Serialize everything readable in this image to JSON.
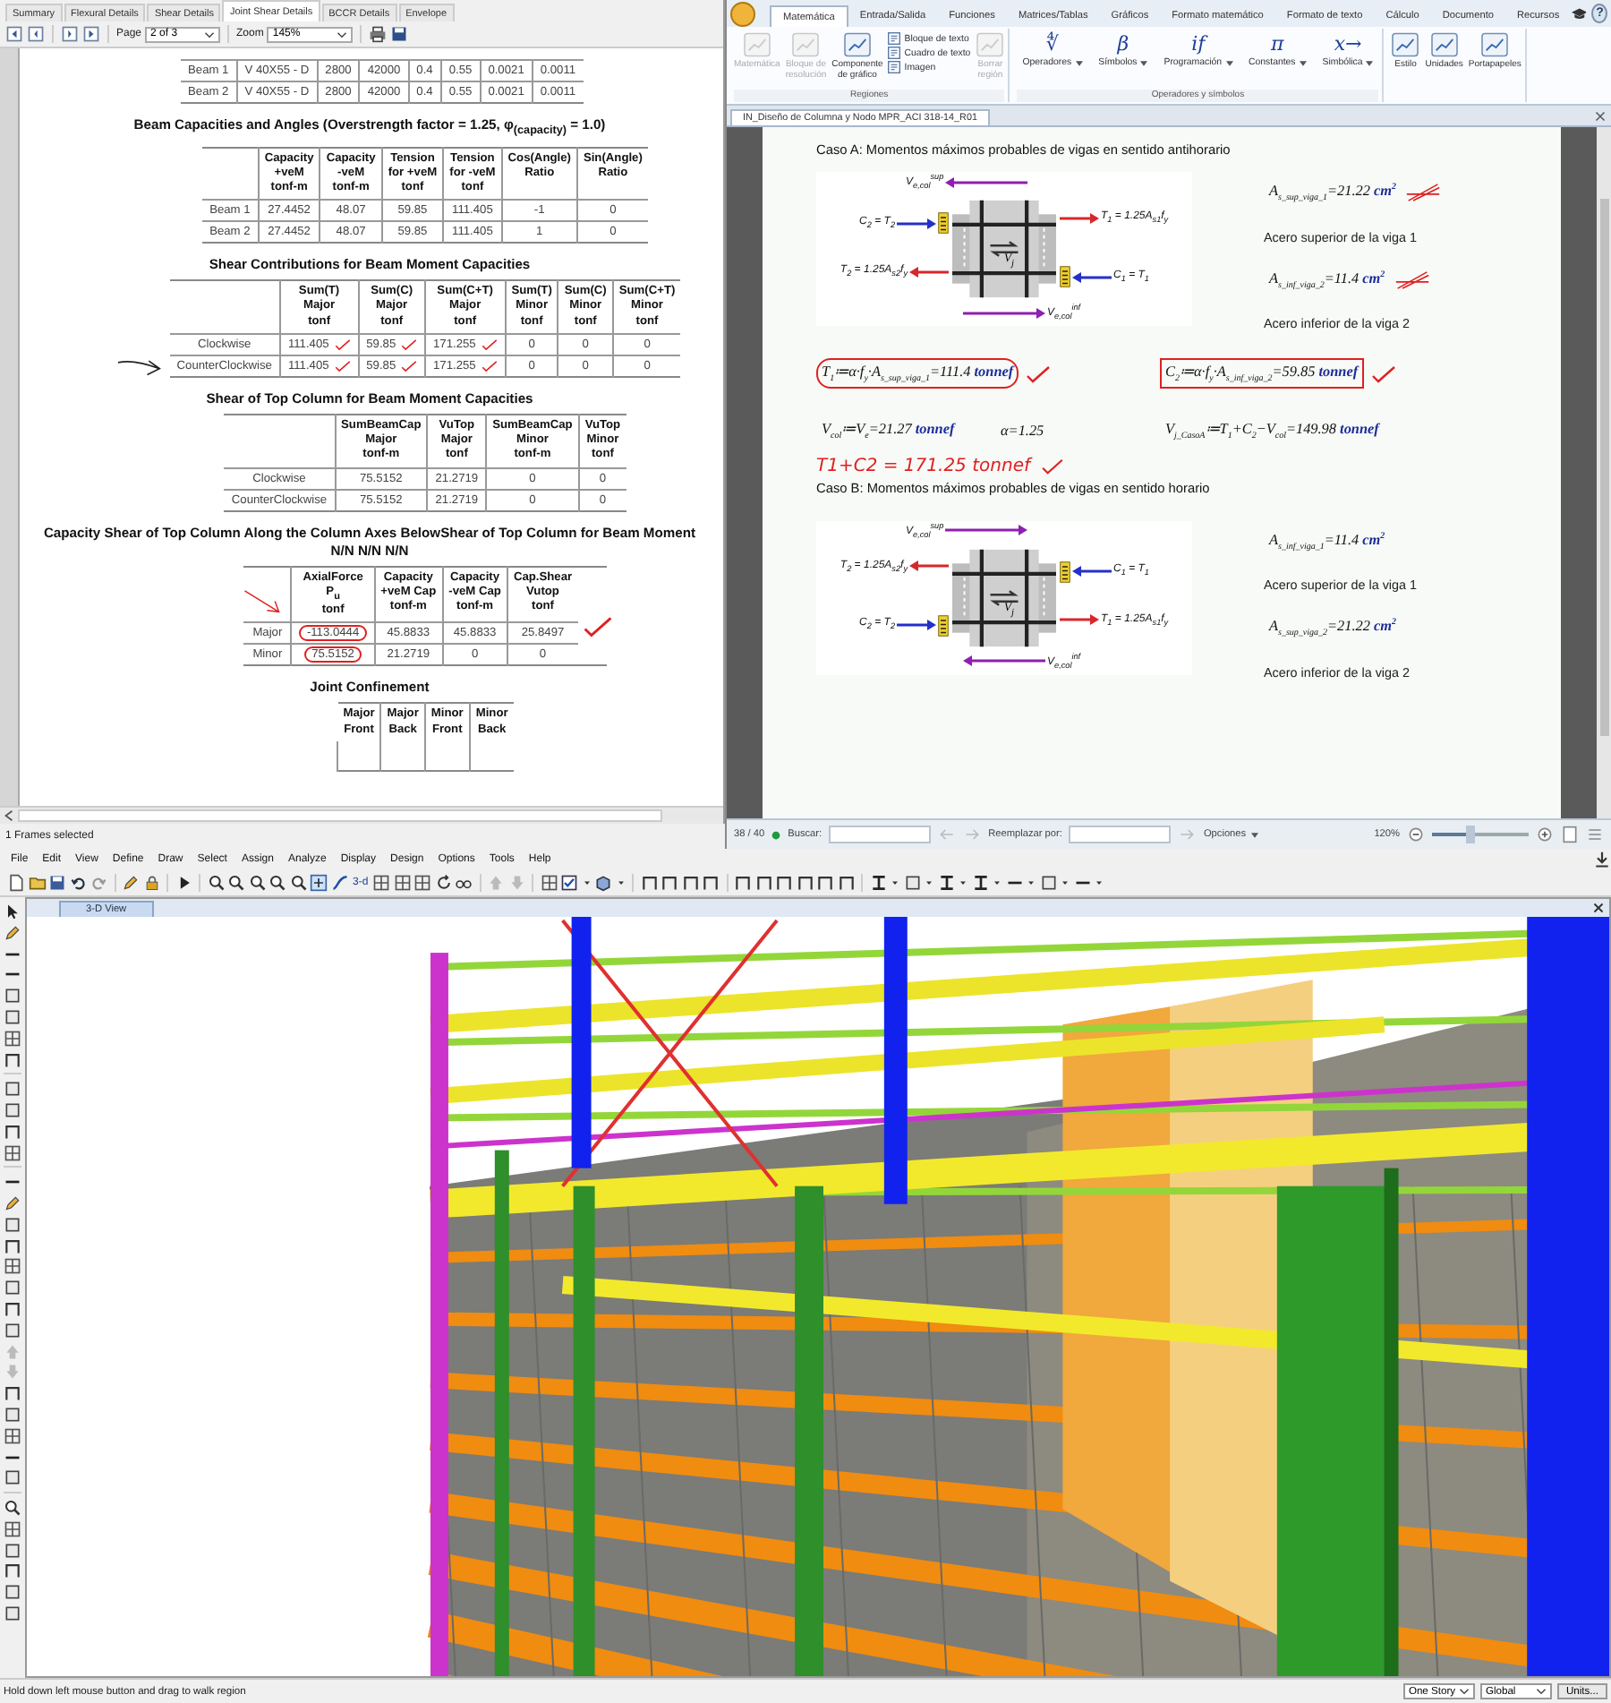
{
  "report": {
    "tabs": [
      {
        "label": "Summary",
        "selected": false
      },
      {
        "label": "Flexural Details",
        "selected": false
      },
      {
        "label": "Shear Details",
        "selected": false
      },
      {
        "label": "Joint Shear Details",
        "selected": true
      },
      {
        "label": "BCCR Details",
        "selected": false
      },
      {
        "label": "Envelope",
        "selected": false
      }
    ],
    "page_label": "Page",
    "page_value": "2 of 3",
    "zoom_label": "Zoom",
    "zoom_value": "145%",
    "sections": [
      {
        "rows": [
          {
            "label": "Beam 1",
            "cells": [
              "V 40X55 - D",
              "2800",
              "42000",
              "0.4",
              "0.55",
              "0.0021",
              "0.0011"
            ]
          },
          {
            "label": "Beam 2",
            "cells": [
              "V 40X55 - D",
              "2800",
              "42000",
              "0.4",
              "0.55",
              "0.0021",
              "0.0011"
            ]
          }
        ]
      },
      {
        "title": "Beam Capacities and Angles (Overstrength factor = 1.25, φ$_{(capacity)}$ = 1.0)",
        "columns": [
          "Capacity\n+veM\ntonf-m",
          "Capacity\n-veM\ntonf-m",
          "Tension\nfor +veM\ntonf",
          "Tension\nfor -veM\ntonf",
          "Cos(Angle)\nRatio",
          "Sin(Angle)\nRatio"
        ],
        "rows": [
          {
            "label": "Beam 1",
            "cells": [
              "27.4452",
              "48.07",
              "59.85",
              "111.405",
              "-1",
              "0"
            ]
          },
          {
            "label": "Beam 2",
            "cells": [
              "27.4452",
              "48.07",
              "59.85",
              "111.405",
              "1",
              "0"
            ]
          }
        ]
      },
      {
        "title": "Shear Contributions for Beam Moment Capacities",
        "columns": [
          "Sum(T)\nMajor\ntonf",
          "Sum(C)\nMajor\ntonf",
          "Sum(C+T)\nMajor\ntonf",
          "Sum(T)\nMinor\ntonf",
          "Sum(C)\nMinor\ntonf",
          "Sum(C+T)\nMinor\ntonf"
        ],
        "rows": [
          {
            "label": "Clockwise",
            "cells": [
              "111.405",
              "59.85",
              "171.255",
              "0",
              "0",
              "0"
            ],
            "ticks": [
              true,
              true,
              true,
              false,
              false,
              false
            ],
            "arrow": false
          },
          {
            "label": "CounterClockwise",
            "cells": [
              "111.405",
              "59.85",
              "171.255",
              "0",
              "0",
              "0"
            ],
            "ticks": [
              true,
              true,
              true,
              false,
              false,
              false
            ],
            "arrow": true
          }
        ]
      },
      {
        "title": "Shear of Top Column for Beam Moment Capacities",
        "columns": [
          "SumBeamCap\nMajor\ntonf-m",
          "VuTop\nMajor\ntonf",
          "SumBeamCap\nMinor\ntonf-m",
          "VuTop\nMinor\ntonf"
        ],
        "rows": [
          {
            "label": "Clockwise",
            "cells": [
              "75.5152",
              "21.2719",
              "0",
              "0"
            ]
          },
          {
            "label": "CounterClockwise",
            "cells": [
              "75.5152",
              "21.2719",
              "0",
              "0"
            ]
          }
        ]
      },
      {
        "title": "Capacity Shear of Top Column Along the Column Axes BelowShear of Top Column for Beam Moment",
        "subtitle": "N/N N/N N/N",
        "columns": [
          "AxialForce\nP$_{u}$\ntonf",
          "Capacity\n+veM Cap\ntonf-m",
          "Capacity\n-veM Cap\ntonf-m",
          "Cap.Shear\nVutop\ntonf"
        ],
        "rows": [
          {
            "label": "Major",
            "cells": [
              "-113.0444",
              "45.8833",
              "45.8833",
              "25.8497"
            ],
            "circled": [
              true,
              false,
              false,
              false
            ],
            "end_tick": true
          },
          {
            "label": "Minor",
            "cells": [
              "75.5152",
              "21.2719",
              "0",
              "0"
            ],
            "circled": [
              true,
              false,
              false,
              false
            ],
            "end_tick": false
          }
        ]
      },
      {
        "title": "Joint Confinement",
        "columns": [
          "Major\nFront",
          "Major\nBack",
          "Minor\nFront",
          "Minor\nBack"
        ]
      }
    ]
  },
  "selection_status": "1 Frames selected",
  "mathcad": {
    "tabs": [
      {
        "label": "Matemática",
        "selected": true
      },
      {
        "label": "Entrada/Salida",
        "selected": false
      },
      {
        "label": "Funciones",
        "selected": false
      },
      {
        "label": "Matrices/Tablas",
        "selected": false
      },
      {
        "label": "Gráficos",
        "selected": false
      },
      {
        "label": "Formato matemático",
        "selected": false
      },
      {
        "label": "Formato de texto",
        "selected": false
      },
      {
        "label": "Cálculo",
        "selected": false
      },
      {
        "label": "Documento",
        "selected": false
      },
      {
        "label": "Recursos",
        "selected": false
      }
    ],
    "help": "?",
    "groups": [
      {
        "label": "Regiones",
        "items": [
          {
            "kind": "large",
            "label": "Matemática",
            "disabled": true
          },
          {
            "kind": "large",
            "label": "Bloque de\nresolución",
            "disabled": true
          },
          {
            "kind": "large",
            "label": "Componente\nde gráfico",
            "disabled": false
          },
          {
            "kind": "small",
            "label": "Bloque de texto",
            "disabled": false
          },
          {
            "kind": "small",
            "label": "Cuadro de texto",
            "disabled": false
          },
          {
            "kind": "small",
            "label": "Imagen",
            "disabled": false
          },
          {
            "kind": "large",
            "label": "Borrar\nregión",
            "disabled": true
          }
        ]
      },
      {
        "label": "Operadores y símbolos",
        "items": [
          {
            "kind": "glyph",
            "glyph": "∜",
            "label": "Operadores",
            "disabled": false
          },
          {
            "kind": "glyph",
            "glyph": "β",
            "label": "Símbolos",
            "disabled": false
          },
          {
            "kind": "glyph",
            "glyph": "if",
            "label": "Programación",
            "disabled": false
          },
          {
            "kind": "glyph",
            "glyph": "π",
            "label": "Constantes",
            "disabled": false
          },
          {
            "kind": "glyph",
            "glyph": "x→",
            "label": "Simbólica",
            "disabled": false
          }
        ]
      },
      {
        "items": [
          {
            "kind": "large",
            "label": "Estilo",
            "disabled": false
          },
          {
            "kind": "large",
            "label": "Unidades",
            "disabled": false
          },
          {
            "kind": "large",
            "label": "Portapapeles",
            "disabled": false
          }
        ]
      }
    ],
    "doc_tab": "IN_Diseño de Columna y Nodo MPR_ACI 318-14_R01",
    "cases": [
      {
        "heading": "Caso A: Momentos máximos probables de vigas en sentido antihorario",
        "diagram": {
          "center": "V$_{j}$",
          "labels": [
            {
              "kind": "shear",
              "points_left": true,
              "text": "V$_{e,col}$$^{sup}$"
            },
            {
              "kind": "compression",
              "points_left": false,
              "text": "C$_{2}$ = T$_{2}$"
            },
            {
              "kind": "tension",
              "points_left": false,
              "text": "T$_{1}$ = 1.25A$_{s1}$f$_{y}$"
            },
            {
              "kind": "tension",
              "points_left": true,
              "text": "T$_{2}$ = 1.25A$_{s2}$f$_{y}$"
            },
            {
              "kind": "compression",
              "points_left": true,
              "text": "C$_{1}$ = T$_{1}$"
            },
            {
              "kind": "shear",
              "points_left": false,
              "text": "V$_{e,col}$$^{inf}$"
            }
          ]
        },
        "side": [
          {
            "kind": "formula",
            "expr": "A$_{s_sup_viga_1}$=21.22",
            "unit": "cm$^{2}$",
            "circled": false,
            "boxed": false,
            "struck": true
          },
          {
            "kind": "note",
            "text": "Acero superior de la viga 1"
          },
          {
            "kind": "formula",
            "expr": "A$_{s_inf_viga_2}$=11.4",
            "unit": "cm$^{2}$",
            "circled": false,
            "boxed": false,
            "struck": true
          },
          {
            "kind": "note",
            "text": "Acero inferior de la viga 2"
          }
        ],
        "lines": [
          [
            {
              "expr": "T$_{1}$≔α·f$_{y}$·A$_{s_sup_viga_1}$=111.4",
              "unit": "tonnef",
              "circled": true,
              "boxed": false,
              "struck": false
            },
            {
              "expr": "C$_{2}$≔α·f$_{y}$·A$_{s_inf_viga_2}$=59.85",
              "unit": "tonnef",
              "circled": false,
              "boxed": true,
              "struck": false
            }
          ],
          [
            {
              "expr": "V$_{col}$≔V$_{e}$=21.27",
              "unit": "tonnef",
              "circled": false,
              "boxed": false,
              "struck": false
            },
            {
              "expr": "α=1.25",
              "circled": false,
              "boxed": false,
              "struck": false
            },
            {
              "expr": "V$_{j_CasoA}$≔T$_{1}$+C$_{2}$−V$_{col}$=149.98",
              "unit": "tonnef",
              "circled": false,
              "boxed": false,
              "struck": false
            }
          ]
        ],
        "handwriting": "T1+C2 = 171.25 tonnef"
      },
      {
        "heading": "Caso B: Momentos máximos probables de vigas en sentido horario",
        "diagram": {
          "center": "V$_{j}$",
          "labels": [
            {
              "kind": "shear",
              "points_left": false,
              "text": "V$_{e,col}$$^{sup}$"
            },
            {
              "kind": "tension",
              "points_left": true,
              "text": "T$_{2}$ = 1.25A$_{s2}$f$_{y}$"
            },
            {
              "kind": "compression",
              "points_left": true,
              "text": "C$_{1}$ = T$_{1}$"
            },
            {
              "kind": "compression",
              "points_left": false,
              "text": "C$_{2}$ = T$_{2}$"
            },
            {
              "kind": "tension",
              "points_left": false,
              "text": "T$_{1}$ = 1.25A$_{s1}$f$_{y}$"
            },
            {
              "kind": "shear",
              "points_left": true,
              "text": "V$_{e,col}$$^{inf}$"
            }
          ]
        },
        "side": [
          {
            "kind": "formula",
            "expr": "A$_{s_inf_viga_1}$=11.4",
            "unit": "cm$^{2}$",
            "circled": false,
            "boxed": false,
            "struck": false
          },
          {
            "kind": "note",
            "text": "Acero superior de la viga 1"
          },
          {
            "kind": "formula",
            "expr": "A$_{s_sup_viga_2}$=21.22",
            "unit": "cm$^{2}$",
            "circled": false,
            "boxed": false,
            "struck": false
          },
          {
            "kind": "note",
            "text": "Acero inferior de la viga 2"
          }
        ]
      }
    ],
    "status": {
      "page": "38 / 40",
      "find_label": "Buscar:",
      "replace_label": "Reemplazar por:",
      "options": "Opciones",
      "zoom": "120%",
      "zoom_slider": {
        "level": 0.45
      }
    }
  },
  "etabs": {
    "menu": [
      "File",
      "Edit",
      "View",
      "Define",
      "Draw",
      "Select",
      "Assign",
      "Analyze",
      "Display",
      "Design",
      "Options",
      "Tools",
      "Help"
    ],
    "view_3d_label": "3-d",
    "view_tab": "3-D View",
    "status": "Hold down left mouse button and drag to walk region",
    "story_option": "One Story",
    "coord_option": "Global",
    "units_button": "Units..."
  }
}
